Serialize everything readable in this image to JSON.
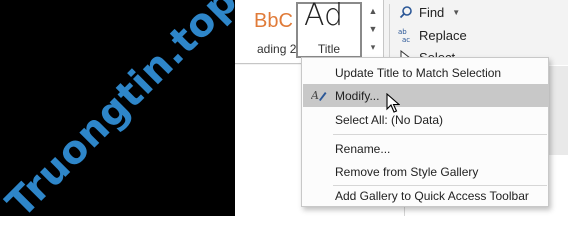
{
  "watermark": "Truongtin.top",
  "style_gallery": {
    "heading2": {
      "sample": "BbC",
      "name": "ading 2"
    },
    "title": {
      "sample": "Ad",
      "name": "Title"
    }
  },
  "editing": {
    "find_label": "Find",
    "replace_label": "Replace",
    "select_label": "Select"
  },
  "context_menu": {
    "items": [
      {
        "label": "Update Title to Match Selection"
      },
      {
        "label": "Modify..."
      },
      {
        "label": "Select All: (No Data)"
      },
      {
        "label": "Rename..."
      },
      {
        "label": "Remove from Style Gallery"
      },
      {
        "label": "Add Gallery to Quick Access Toolbar"
      }
    ]
  },
  "colors": {
    "watermark": "#2e86c9",
    "heading2_sample": "#e07b39",
    "highlight": "#c8c8c8"
  }
}
